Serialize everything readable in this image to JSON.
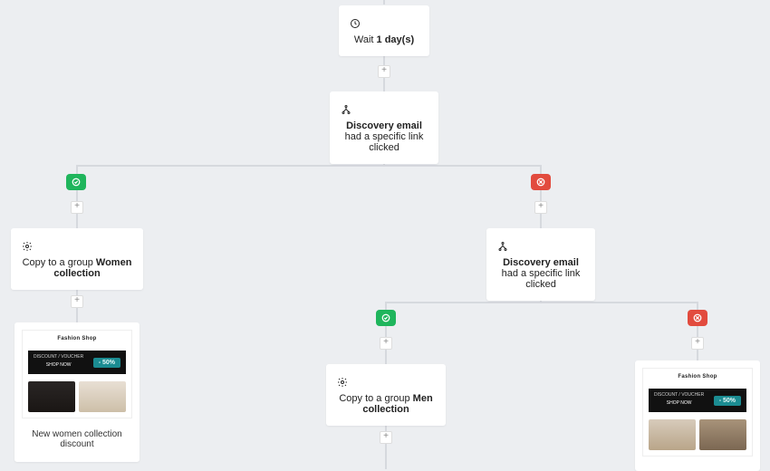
{
  "wait": {
    "prefix": "Wait",
    "bold": "1 day(s)"
  },
  "condition1": {
    "bold": "Discovery email",
    "suffix": " had a specific link clicked"
  },
  "condition2": {
    "bold": "Discovery email",
    "suffix": " had a specific link clicked"
  },
  "actionWomen": {
    "prefix": "Copy to a group ",
    "bold": "Women collection"
  },
  "actionMen": {
    "prefix": "Copy to a group ",
    "bold": "Men collection"
  },
  "cardWomen": {
    "logo": "Fashion Shop",
    "bannerTitle": "DISCOUNT / VOUCHER",
    "badge": "- 50%",
    "caption": "New women collection discount"
  },
  "cardMen": {
    "logo": "Fashion Shop",
    "bannerTitle": "DISCOUNT / VOUCHER",
    "badge": "- 50%"
  }
}
